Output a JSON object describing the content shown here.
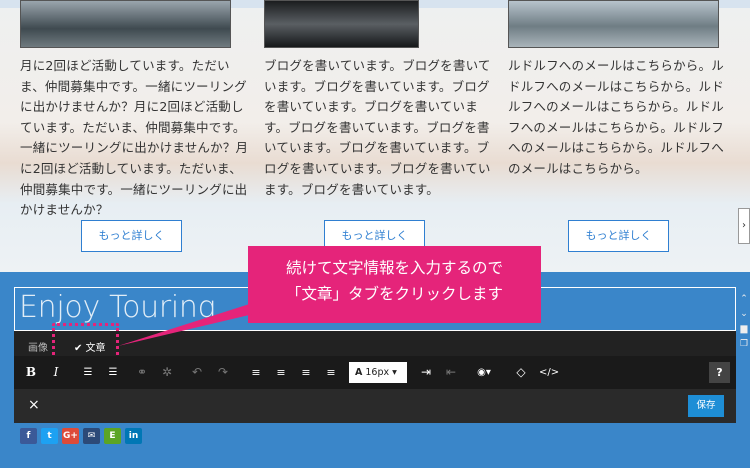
{
  "columns": [
    {
      "text": "月に2回ほど活動しています。ただいま、仲間募集中です。一緒にツーリングに出かけませんか？月に2回ほど活動しています。ただいま、仲間募集中です。一緒にツーリングに出かけませんか？月に2回ほど活動しています。ただいま、仲間募集中です。一緒にツーリングに出かけませんか？",
      "more_label": "もっと詳しく"
    },
    {
      "text": "ブログを書いています。ブログを書いています。ブログを書いています。ブログを書いています。ブログを書いています。ブログを書いています。ブログを書いています。ブログを書いています。ブログを書いています。ブログを書いています。ブログを書いています。",
      "more_label": "もっと詳しく"
    },
    {
      "text": "ルドルフへのメールはこちらから。ルドルフへのメールはこちらから。ルドルフへのメールはこちらから。ルドルフへのメールはこちらから。ルドルフへのメールはこちらから。ルドルフへのメールはこちらから。",
      "more_label": "もっと詳しく"
    }
  ],
  "editor": {
    "title_text": "Enjoy Touring",
    "tabs": {
      "image": "画像",
      "text": "✔ 文章"
    },
    "font_size": "16px",
    "close_label": "×",
    "save_label": "保存",
    "help_label": "?"
  },
  "callout": {
    "line1": "続けて文字情報を入力するので",
    "line2": "「文章」タブをクリックします"
  },
  "social": [
    "f",
    "t",
    "G+",
    "✉",
    "E",
    "in"
  ],
  "colors": {
    "accent": "#2f7fd1",
    "callout": "#e5247a",
    "editor_bg": "#3a86c9",
    "save": "#1e8ed6"
  }
}
